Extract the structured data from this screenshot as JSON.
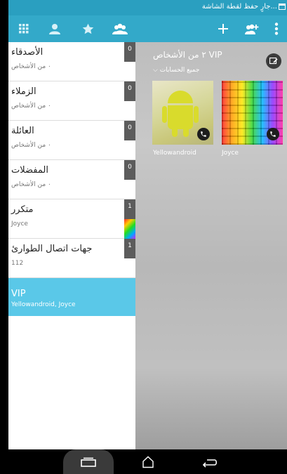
{
  "status_bar": {
    "text": "جارٍ حفظ لقطة الشاشة..."
  },
  "action_bar": {
    "icons": [
      "apps-grid-icon",
      "person-icon",
      "star-icon",
      "groups-icon",
      "add-icon",
      "add-group-icon",
      "overflow-menu-icon"
    ]
  },
  "groups": [
    {
      "name": "الأصدقاء",
      "subtitle": "٠ من الأشخاص",
      "count": "0"
    },
    {
      "name": "الزملاء",
      "subtitle": "٠ من الأشخاص",
      "count": "0"
    },
    {
      "name": "العائلة",
      "subtitle": "٠ من الأشخاص",
      "count": "0"
    },
    {
      "name": "المفضلات",
      "subtitle": "٠ من الأشخاص",
      "count": "0"
    },
    {
      "name": "متكرر",
      "subtitle": "Joyce",
      "count": "1"
    },
    {
      "name": "جهات اتصال الطوارئ",
      "subtitle": "112",
      "count": "1"
    },
    {
      "name": "VIP",
      "subtitle": "Yellowandroid, Joyce",
      "selected": true
    }
  ],
  "detail": {
    "title": "٢ من الأشخاص VIP",
    "account_filter": "جميع الحسابات",
    "contacts": [
      {
        "name": "Yellowandroid"
      },
      {
        "name": "Joyce"
      }
    ]
  },
  "colors": {
    "status_bar": "#2a9fc0",
    "action_bar": "#33a9c9",
    "selected_item": "#5ac8e8",
    "count_badge": "#5c5c5c"
  }
}
